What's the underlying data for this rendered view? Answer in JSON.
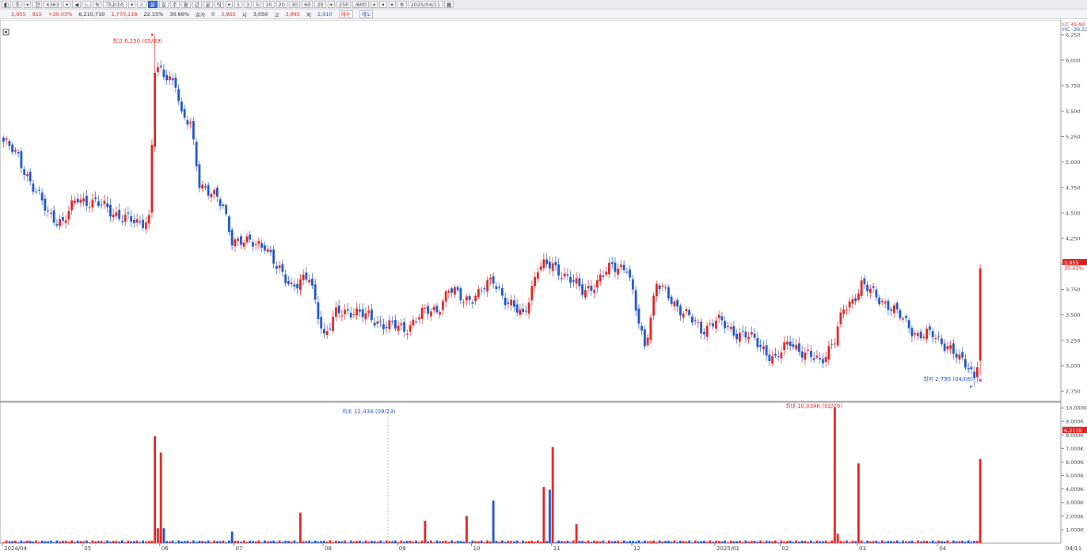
{
  "toolbar": {
    "items": [
      "◧",
      "조",
      "▾",
      "현",
      "6363",
      "▾",
      "◀",
      "▷",
      "N",
      "기나너스",
      "▾",
      "✓",
      "분",
      "일",
      "주",
      "월",
      "년",
      "분",
      "틱",
      "▾",
      "1",
      "3",
      "5",
      "10",
      "20",
      "30",
      "60",
      "20",
      "▾",
      "250",
      "/600",
      "▾",
      "▾",
      "▾",
      "⚙",
      "2025/04/11",
      "▦"
    ],
    "symbol_code": "6363",
    "stock_name": "기나너스",
    "count": "250",
    "count_total": "/600",
    "date": "2025/04/11"
  },
  "quote": {
    "price": "3,955",
    "change": "915",
    "change_pct": "+30.03%",
    "volume": "6,210,710",
    "amount": "1,770,118",
    "turnover": "22.15%",
    "vol_ratio": "30.66%",
    "bid_label": "호가",
    "bid_value": "0",
    "ask_value": "3,955",
    "open_label": "시",
    "open": "3,050",
    "high_label": "고",
    "high": "3,995",
    "low_label": "저",
    "low": "2,910",
    "buy_btn": "매수",
    "sell_btn": "매도"
  },
  "price_panel": {
    "top_label": "LC 45.92",
    "top_label2": "HC -36.53",
    "y_ticks": [
      "6,250",
      "6,000",
      "5,750",
      "5,500",
      "5,250",
      "5,000",
      "4,750",
      "4,500",
      "4,250",
      "4,000",
      "3,750",
      "3,500",
      "3,250",
      "3,000",
      "2,750"
    ],
    "current_price_tag": "3,955",
    "current_pct_tag": "30.03%",
    "high_annotation": "최고 6,250 (05/09)",
    "low_annotation": "최저 2,795 (04/08)"
  },
  "volume_panel": {
    "y_ticks": [
      "10,000K",
      "9,000K",
      "8,000K",
      "7,000K",
      "6,000K",
      "5,000K",
      "4,000K",
      "3,000K",
      "2,000K",
      "1,000K"
    ],
    "current_tag": "6,211K",
    "min_annotation": "최소 12,434 (09/23)",
    "max_annotation": "최대 10,034K (02/26)"
  },
  "x_axis": {
    "labels": [
      "2024/04",
      "05",
      "06",
      "07",
      "08",
      "09",
      "10",
      "11",
      "12",
      "2025/01",
      "02",
      "03",
      "04"
    ],
    "last_label": "04/11"
  },
  "colors": {
    "up": "#e02020",
    "down": "#1a52c8",
    "grid": "#e6e6e6"
  },
  "chart_data": {
    "type": "candlestick",
    "price_range": [
      2650,
      6350
    ],
    "volume_range": [
      0,
      10300
    ],
    "volume_unit": "K",
    "anchors": [
      [
        0,
        5200
      ],
      [
        5,
        5050
      ],
      [
        10,
        4750
      ],
      [
        15,
        4500
      ],
      [
        20,
        4400
      ],
      [
        25,
        4650
      ],
      [
        30,
        4600
      ],
      [
        35,
        4550
      ],
      [
        40,
        4450
      ],
      [
        45,
        4400
      ],
      [
        49,
        4450
      ],
      [
        51,
        5900
      ],
      [
        54,
        5850
      ],
      [
        58,
        5800
      ],
      [
        60,
        5450
      ],
      [
        63,
        5350
      ],
      [
        66,
        4800
      ],
      [
        70,
        4700
      ],
      [
        74,
        4550
      ],
      [
        77,
        4250
      ],
      [
        82,
        4200
      ],
      [
        88,
        4200
      ],
      [
        92,
        3950
      ],
      [
        97,
        3800
      ],
      [
        103,
        3850
      ],
      [
        108,
        3300
      ],
      [
        112,
        3500
      ],
      [
        118,
        3550
      ],
      [
        124,
        3450
      ],
      [
        130,
        3400
      ],
      [
        135,
        3350
      ],
      [
        140,
        3500
      ],
      [
        146,
        3550
      ],
      [
        150,
        3750
      ],
      [
        155,
        3650
      ],
      [
        160,
        3700
      ],
      [
        165,
        3850
      ],
      [
        170,
        3600
      ],
      [
        175,
        3500
      ],
      [
        180,
        3950
      ],
      [
        185,
        4000
      ],
      [
        190,
        3850
      ],
      [
        195,
        3750
      ],
      [
        200,
        3800
      ],
      [
        205,
        4000
      ],
      [
        210,
        3950
      ],
      [
        213,
        3550
      ],
      [
        216,
        3200
      ],
      [
        220,
        3800
      ],
      [
        225,
        3650
      ],
      [
        230,
        3500
      ],
      [
        235,
        3350
      ],
      [
        240,
        3450
      ],
      [
        245,
        3350
      ],
      [
        250,
        3300
      ],
      [
        255,
        3200
      ],
      [
        260,
        3050
      ],
      [
        265,
        3250
      ],
      [
        270,
        3100
      ],
      [
        275,
        3050
      ],
      [
        280,
        3250
      ],
      [
        283,
        3550
      ],
      [
        286,
        3650
      ],
      [
        289,
        3800
      ],
      [
        293,
        3700
      ],
      [
        298,
        3600
      ],
      [
        303,
        3450
      ],
      [
        308,
        3300
      ],
      [
        313,
        3300
      ],
      [
        318,
        3200
      ],
      [
        322,
        3050
      ],
      [
        325,
        3000
      ],
      [
        327,
        2900
      ],
      [
        328,
        3050
      ],
      [
        329,
        3955
      ]
    ],
    "volume_spikes": [
      [
        51,
        7900
      ],
      [
        52,
        1100
      ],
      [
        53,
        6700
      ],
      [
        54,
        1100
      ],
      [
        77,
        850
      ],
      [
        100,
        2250
      ],
      [
        142,
        1650
      ],
      [
        156,
        2000
      ],
      [
        165,
        3150
      ],
      [
        182,
        4150
      ],
      [
        184,
        3950
      ],
      [
        185,
        7100
      ],
      [
        193,
        1400
      ],
      [
        280,
        10034
      ],
      [
        281,
        700
      ],
      [
        288,
        5900
      ],
      [
        329,
        6211
      ]
    ],
    "high_point": {
      "date": "05/09",
      "value": 6250
    },
    "low_point": {
      "date": "04/08",
      "value": 2795
    },
    "max_volume": {
      "date": "02/26",
      "value": 10034
    },
    "min_volume": {
      "date": "09/23",
      "value": 12.434
    },
    "x_label_positions": [
      [
        "2024/04",
        0
      ],
      [
        "05",
        27
      ],
      [
        "06",
        53
      ],
      [
        "07",
        78
      ],
      [
        "08",
        108
      ],
      [
        "09",
        133
      ],
      [
        "10",
        158
      ],
      [
        "11",
        185
      ],
      [
        "12",
        212
      ],
      [
        "2025/01",
        240
      ],
      [
        "02",
        262
      ],
      [
        "03",
        288
      ],
      [
        "04",
        315
      ]
    ]
  }
}
